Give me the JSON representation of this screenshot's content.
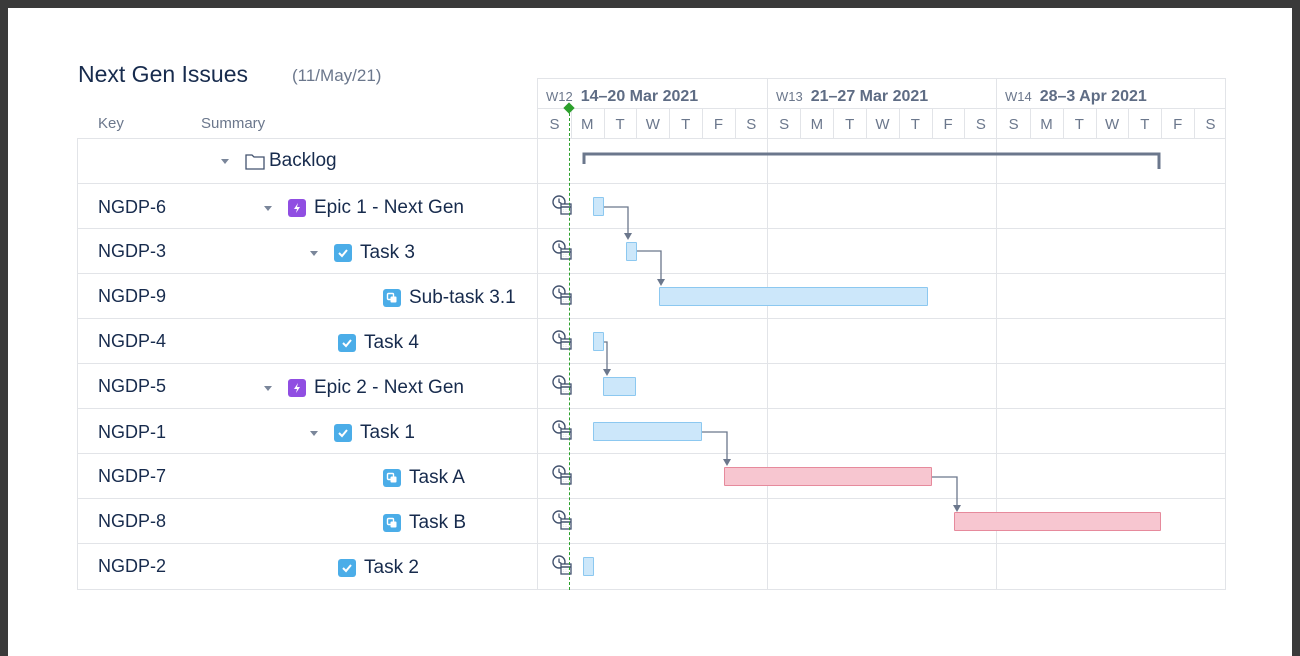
{
  "page": {
    "title": "Next Gen Issues",
    "subtitle": "(11/May/21)"
  },
  "columns": {
    "key": "Key",
    "summary": "Summary"
  },
  "backlog": {
    "label": "Backlog",
    "icon": "folder-icon"
  },
  "rows": [
    {
      "key": "NGDP-6",
      "summary": "Epic 1 - Next Gen",
      "type": "epic",
      "icon": "epic-icon"
    },
    {
      "key": "NGDP-3",
      "summary": "Task 3",
      "type": "task",
      "icon": "task-icon"
    },
    {
      "key": "NGDP-9",
      "summary": "Sub-task 3.1",
      "type": "subtask",
      "icon": "subtask-icon"
    },
    {
      "key": "NGDP-4",
      "summary": "Task 4",
      "type": "task",
      "icon": "task-icon"
    },
    {
      "key": "NGDP-5",
      "summary": "Epic 2 - Next Gen",
      "type": "epic",
      "icon": "epic-icon"
    },
    {
      "key": "NGDP-1",
      "summary": "Task 1",
      "type": "task",
      "icon": "task-icon"
    },
    {
      "key": "NGDP-7",
      "summary": "Task A",
      "type": "subtask",
      "icon": "subtask-icon"
    },
    {
      "key": "NGDP-8",
      "summary": "Task B",
      "type": "subtask",
      "icon": "subtask-icon"
    },
    {
      "key": "NGDP-2",
      "summary": "Task 2",
      "type": "task",
      "icon": "task-icon"
    }
  ],
  "timeline": {
    "weeks": [
      {
        "num": "W12",
        "range": "14–20 Mar 2021"
      },
      {
        "num": "W13",
        "range": "21–27 Mar 2021"
      },
      {
        "num": "W14",
        "range": "28–3 Apr 2021"
      }
    ],
    "days": [
      "S",
      "M",
      "T",
      "W",
      "T",
      "F",
      "S",
      "S",
      "M",
      "T",
      "W",
      "T",
      "F",
      "S",
      "S",
      "M",
      "T",
      "W",
      "T",
      "F",
      "S"
    ],
    "colors": {
      "bar_blue": "#cce7fa",
      "bar_pink": "#f7c6d0",
      "today_line": "#2ca02c",
      "epic": "#904ee2",
      "task": "#4bade8"
    }
  }
}
